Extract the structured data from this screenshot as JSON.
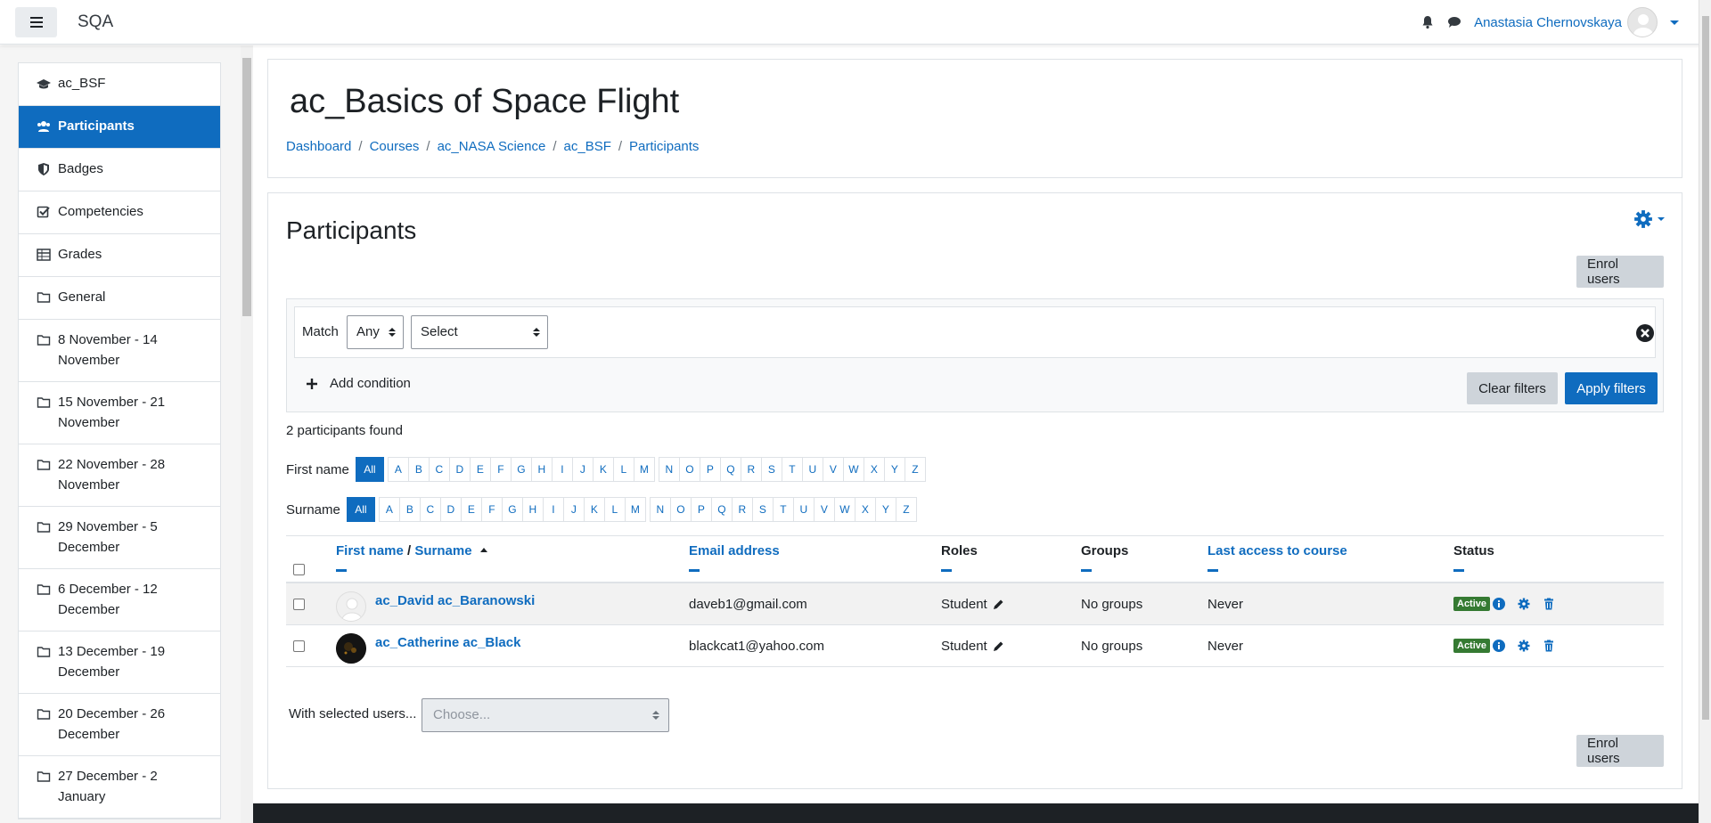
{
  "navbar": {
    "site_name": "SQA",
    "user_name": "Anastasia Chernovskaya",
    "icons": [
      "menu-icon",
      "bell-icon",
      "chat-icon",
      "user-avatar",
      "caret-down-icon"
    ]
  },
  "drawer": {
    "items": [
      {
        "label": "ac_BSF",
        "icon": "graduation-cap-icon"
      },
      {
        "label": "Participants",
        "icon": "users-icon",
        "active": true
      },
      {
        "label": "Badges",
        "icon": "shield-icon"
      },
      {
        "label": "Competencies",
        "icon": "check-square-icon"
      },
      {
        "label": "Grades",
        "icon": "table-icon"
      },
      {
        "label": "General",
        "icon": "folder-icon"
      },
      {
        "label": "8 November - 14 November",
        "icon": "folder-icon"
      },
      {
        "label": "15 November - 21 November",
        "icon": "folder-icon"
      },
      {
        "label": "22 November - 28 November",
        "icon": "folder-icon"
      },
      {
        "label": "29 November - 5 December",
        "icon": "folder-icon"
      },
      {
        "label": "6 December - 12 December",
        "icon": "folder-icon"
      },
      {
        "label": "13 December - 19 December",
        "icon": "folder-icon"
      },
      {
        "label": "20 December - 26 December",
        "icon": "folder-icon"
      },
      {
        "label": "27 December - 2 January",
        "icon": "folder-icon"
      }
    ]
  },
  "header": {
    "title": "ac_Basics of Space Flight",
    "breadcrumb": [
      "Dashboard",
      "Courses",
      "ac_NASA Science",
      "ac_BSF",
      "Participants"
    ]
  },
  "main": {
    "title": "Participants",
    "enrol_label": "Enrol users",
    "filter": {
      "match_label": "Match",
      "match_value": "Any",
      "select_value": "Select",
      "add_condition": "Add condition",
      "clear_label": "Clear filters",
      "apply_label": "Apply filters"
    },
    "found_text": "2 participants found",
    "first_name_label": "First name",
    "surname_label": "Surname",
    "all_label": "All",
    "letters": [
      "A",
      "B",
      "C",
      "D",
      "E",
      "F",
      "G",
      "H",
      "I",
      "J",
      "K",
      "L",
      "M",
      "N",
      "O",
      "P",
      "Q",
      "R",
      "S",
      "T",
      "U",
      "V",
      "W",
      "X",
      "Y",
      "Z"
    ],
    "columns": {
      "first_name": "First name",
      "name_sep": "/",
      "surname": "Surname",
      "email": "Email address",
      "roles": "Roles",
      "groups": "Groups",
      "last_access": "Last access to course",
      "status": "Status"
    },
    "rows": [
      {
        "name": "ac_David ac_Baranowski",
        "email": "daveb1@gmail.com",
        "role": "Student",
        "groups": "No groups",
        "last_access": "Never",
        "status": "Active",
        "avatar": "default"
      },
      {
        "name": "ac_Catherine ac_Black",
        "email": "blackcat1@yahoo.com",
        "role": "Student",
        "groups": "No groups",
        "last_access": "Never",
        "status": "Active",
        "avatar": "photo"
      }
    ],
    "with_selected_label": "With selected users...",
    "choose_placeholder": "Choose..."
  },
  "colors": {
    "primary": "#0f6cbf",
    "active_badge": "#357a32",
    "secondary_button": "#ced4da"
  }
}
